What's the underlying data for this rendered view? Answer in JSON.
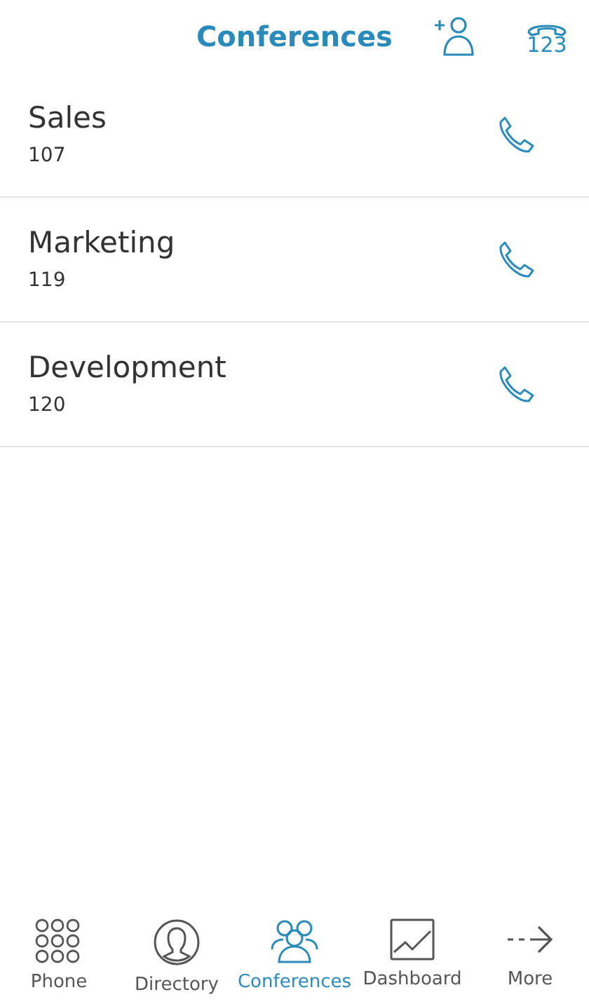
{
  "header": {
    "title": "Conferences",
    "dialpad_label": "123"
  },
  "conferences": [
    {
      "name": "Sales",
      "number": "107"
    },
    {
      "name": "Marketing",
      "number": "119"
    },
    {
      "name": "Development",
      "number": "120"
    }
  ],
  "tab_bar": [
    {
      "kind": "keypad",
      "label": "Phone",
      "selected": false
    },
    {
      "kind": "person",
      "label": "Directory",
      "selected": false
    },
    {
      "kind": "group",
      "label": "Conferences",
      "selected": true
    },
    {
      "kind": "chart",
      "label": "Dashboard",
      "selected": false
    },
    {
      "kind": "arrow",
      "label": "More",
      "selected": false
    }
  ]
}
